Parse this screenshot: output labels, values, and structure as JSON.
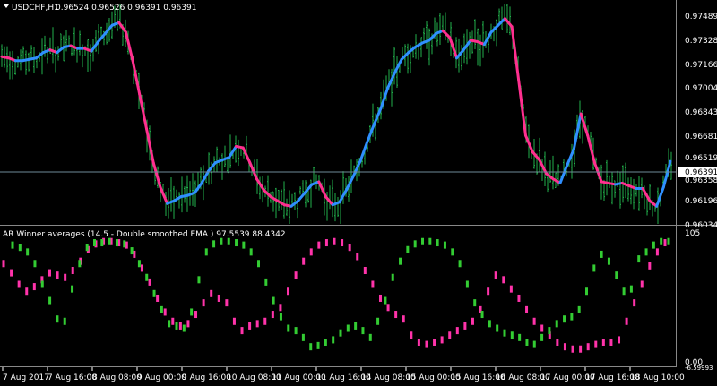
{
  "colors": {
    "background": "#000000",
    "bar_up": "#22b14c",
    "ma_up": "#2f8fff",
    "ma_down": "#ff2f8f",
    "osc_up": "#33cc33",
    "osc_down": "#ff33aa",
    "text": "#ffffff",
    "grid_line": "#5a5a5a",
    "current_price_line": "#6e8a98"
  },
  "main_header": {
    "icon": "dropdown-triangle-icon",
    "symbol": "USDCHF,H1",
    "ohlc": "0.96524 0.96526 0.96391 0.96391"
  },
  "indicator_header": {
    "text": "AR Winner averages (14.5 - Double smoothed EMA ) 97.5539 88.4342"
  },
  "price_axis_labels": [
    "0.97489",
    "0.97328",
    "0.97166",
    "0.97004",
    "0.96843",
    "0.96681",
    "0.96519",
    "0.96358",
    "0.96196",
    "0.96034"
  ],
  "current_price": "0.96391",
  "indicator_axis_labels": [
    "105",
    "0.00",
    "-6.59993"
  ],
  "time_axis_labels": [
    "7 Aug 2017",
    "7 Aug 16:00",
    "8 Aug 08:00",
    "9 Aug 00:00",
    "9 Aug 16:00",
    "10 Aug 08:00",
    "11 Aug 00:00",
    "11 Aug 16:00",
    "14 Aug 08:00",
    "15 Aug 00:00",
    "15 Aug 16:00",
    "16 Aug 08:00",
    "17 Aug 00:00",
    "17 Aug 16:00",
    "18 Aug 10:00"
  ],
  "chart_data": [
    {
      "type": "line",
      "title": "USDCHF,H1",
      "ylim": [
        0.9595,
        0.9757
      ],
      "series": [
        {
          "values": [
            0.9718,
            0.9717,
            0.9715,
            0.9715,
            0.9716,
            0.9717,
            0.9721,
            0.9723,
            0.9721,
            0.9725,
            0.9726,
            0.9724,
            0.9724,
            0.9722,
            0.9729,
            0.9735,
            0.9741,
            0.9743,
            0.9736,
            0.9715,
            0.969,
            0.9665,
            0.964,
            0.9622,
            0.961,
            0.9612,
            0.9615,
            0.9616,
            0.9618,
            0.9625,
            0.9634,
            0.964,
            0.9642,
            0.9644,
            0.9652,
            0.9651,
            0.964,
            0.9628,
            0.962,
            0.9615,
            0.9612,
            0.9609,
            0.9608,
            0.9612,
            0.9618,
            0.9624,
            0.9626,
            0.9615,
            0.9609,
            0.9611,
            0.962,
            0.963,
            0.9641,
            0.9655,
            0.9668,
            0.968,
            0.9695,
            0.9706,
            0.9716,
            0.9721,
            0.9725,
            0.9728,
            0.973,
            0.9735,
            0.9737,
            0.9732,
            0.9717,
            0.9723,
            0.973,
            0.9729,
            0.9727,
            0.9736,
            0.9741,
            0.9746,
            0.974,
            0.97,
            0.966,
            0.9648,
            0.9642,
            0.9632,
            0.9628,
            0.9625,
            0.9638,
            0.965,
            0.9676,
            0.966,
            0.964,
            0.9626,
            0.9625,
            0.9624,
            0.9625,
            0.9623,
            0.9621,
            0.9621,
            0.9612,
            0.9608,
            0.9622,
            0.9641
          ]
        }
      ]
    },
    {
      "type": "scatter",
      "title": "AR Winner averages (14.5 - Double smoothed EMA )",
      "ylim": [
        -6.59993,
        105
      ],
      "series": [
        {
          "values": [
            96,
            94,
            90,
            80,
            62,
            48,
            32,
            30,
            58,
            80,
            94,
            98,
            98,
            99,
            98,
            97,
            91,
            80,
            68,
            54,
            40,
            28,
            26,
            24,
            38,
            66,
            90,
            97,
            99,
            99,
            98,
            96,
            90,
            80,
            64,
            48,
            34,
            24,
            22,
            16,
            8,
            9,
            12,
            14,
            20,
            24,
            26,
            22,
            16,
            30,
            48,
            68,
            82,
            92,
            97,
            99,
            99,
            98,
            96,
            90,
            80,
            62,
            46,
            36,
            28,
            24,
            20,
            18,
            16,
            12,
            10,
            16,
            22,
            28,
            32,
            34,
            40,
            56,
            76,
            88,
            82,
            70,
            56,
            58,
            84,
            90,
            96,
            99,
            99
          ]
        },
        {
          "values": [
            80,
            72,
            62,
            56,
            60,
            66,
            72,
            70,
            68,
            74,
            82,
            92,
            97,
            99,
            99,
            98,
            96,
            88,
            76,
            64,
            50,
            38,
            30,
            26,
            28,
            36,
            46,
            54,
            50,
            46,
            30,
            22,
            26,
            28,
            30,
            36,
            42,
            56,
            70,
            82,
            90,
            96,
            98,
            99,
            98,
            94,
            86,
            74,
            62,
            50,
            42,
            36,
            32,
            18,
            12,
            10,
            12,
            14,
            18,
            22,
            26,
            30,
            40,
            56,
            70,
            66,
            58,
            50,
            40,
            30,
            24,
            18,
            12,
            8,
            6,
            6,
            8,
            10,
            12,
            12,
            14,
            30,
            46,
            62,
            78,
            90,
            98
          ]
        }
      ]
    }
  ]
}
